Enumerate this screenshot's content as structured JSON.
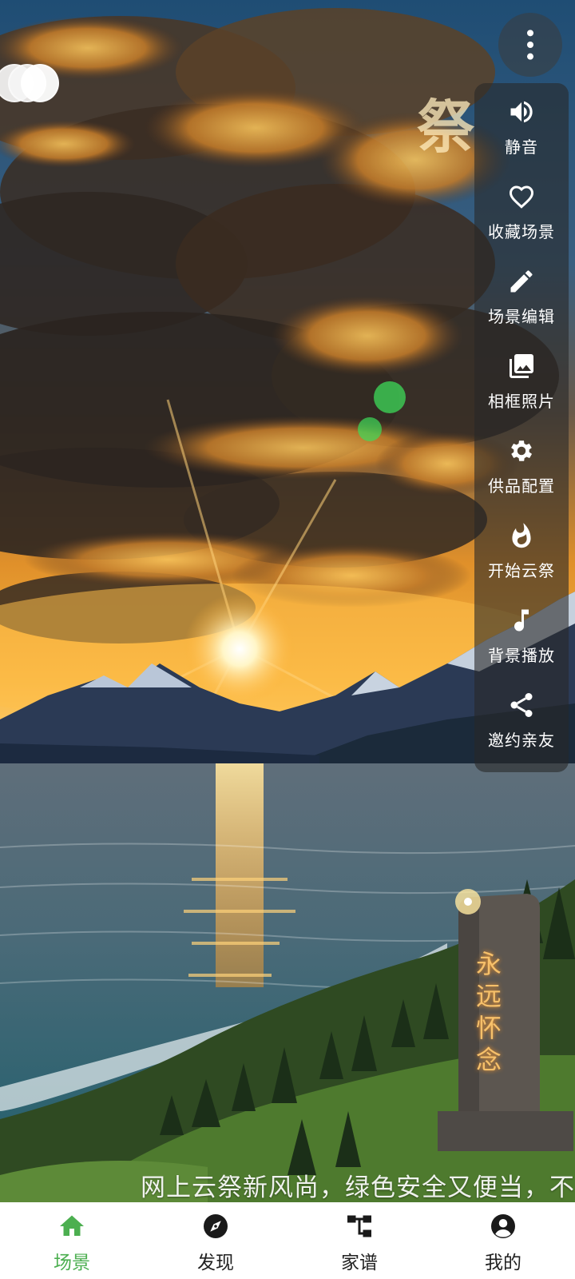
{
  "colors": {
    "accent": "#4caf50",
    "panel_bg": "rgba(40,40,40,0.6)",
    "nav_bg": "#ffffff"
  },
  "scene": {
    "title_char": "祭",
    "tombstone_text": [
      "永",
      "远",
      "怀",
      "念"
    ]
  },
  "more_button": {
    "icon": "more-vertical-icon"
  },
  "actions": [
    {
      "label": "静音",
      "icon": "volume-icon"
    },
    {
      "label": "收藏场景",
      "icon": "heart-icon"
    },
    {
      "label": "场景编辑",
      "icon": "edit-pencil-icon"
    },
    {
      "label": "相框照片",
      "icon": "photo-library-icon"
    },
    {
      "label": "供品配置",
      "icon": "gear-icon"
    },
    {
      "label": "开始云祭",
      "icon": "flame-icon"
    },
    {
      "label": "背景播放",
      "icon": "music-note-icon"
    },
    {
      "label": "邀约亲友",
      "icon": "share-icon"
    }
  ],
  "marquee_text": "网上云祭新风尚，绿色安全又便当，不",
  "nav": [
    {
      "label": "场景",
      "icon": "home-icon",
      "active": true
    },
    {
      "label": "发现",
      "icon": "compass-icon",
      "active": false
    },
    {
      "label": "家谱",
      "icon": "family-tree-icon",
      "active": false
    },
    {
      "label": "我的",
      "icon": "account-icon",
      "active": false
    }
  ]
}
